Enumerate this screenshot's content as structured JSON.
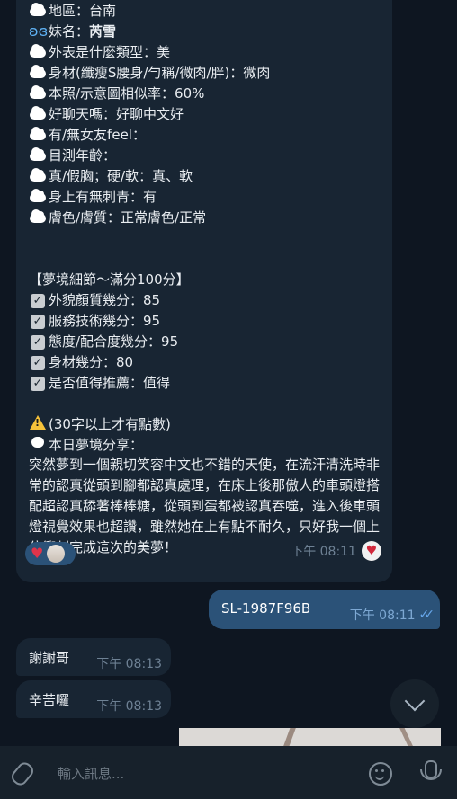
{
  "message_main": {
    "lines": [
      {
        "icon": "cloud-icon",
        "text": "地區：台南"
      },
      {
        "icon": "butterfly-icon",
        "label": "妹名：",
        "value": "芮雪"
      },
      {
        "icon": "cloud-icon",
        "text": "外表是什麼類型：美"
      },
      {
        "icon": "cloud-icon",
        "text": "身材(纖瘦S腰身/勻稱/微肉/胖)：微肉"
      },
      {
        "icon": "cloud-icon",
        "text": "本照/示意圖相似率：60%"
      },
      {
        "icon": "cloud-icon",
        "text": "好聊天嗎：好聊中文好"
      },
      {
        "icon": "cloud-icon",
        "text": "有/無女友feel："
      },
      {
        "icon": "cloud-icon",
        "text": "目測年齡："
      },
      {
        "icon": "cloud-icon",
        "text": "真/假胸；硬/軟：真、軟"
      },
      {
        "icon": "cloud-icon",
        "text": "身上有無刺青：有"
      },
      {
        "icon": "cloud-icon",
        "text": "膚色/膚質：正常膚色/正常"
      }
    ],
    "score_title": "【夢境細節～滿分100分】",
    "scores": [
      {
        "text": "外貌顏質幾分：85"
      },
      {
        "text": "服務技術幾分：95"
      },
      {
        "text": "態度/配合度幾分：95"
      },
      {
        "text": "身材幾分：80"
      },
      {
        "text": "是否值得推薦：值得"
      }
    ],
    "notice": "(30字以上才有點數)",
    "share_title": "本日夢境分享：",
    "story": "突然夢到一個親切笑容中文也不錯的天使，在流汗清洗時非常的認真從頭到腳都認真處理，在床上後那傲人的車頭燈搭配超認真舔著棒棒糖，從頭到蛋都被認真吞噬，進入後車頭燈視覺效果也超讚，雖然她在上有點不耐久，只好我一個上位衝刺完成這次的美夢！",
    "time": "下午 08:11"
  },
  "message_out": {
    "text": "SL-1987F96B",
    "time": "下午 08:11"
  },
  "message_thanks": {
    "text": "謝謝哥",
    "time": "下午 08:13"
  },
  "message_hard": {
    "text": "辛苦囉",
    "time": "下午 08:13"
  },
  "composer": {
    "placeholder": "輸入訊息..."
  },
  "colors": {
    "background": "#0e1621",
    "incoming": "#182533",
    "outgoing": "#2b5278",
    "accent": "#66a6ea"
  }
}
